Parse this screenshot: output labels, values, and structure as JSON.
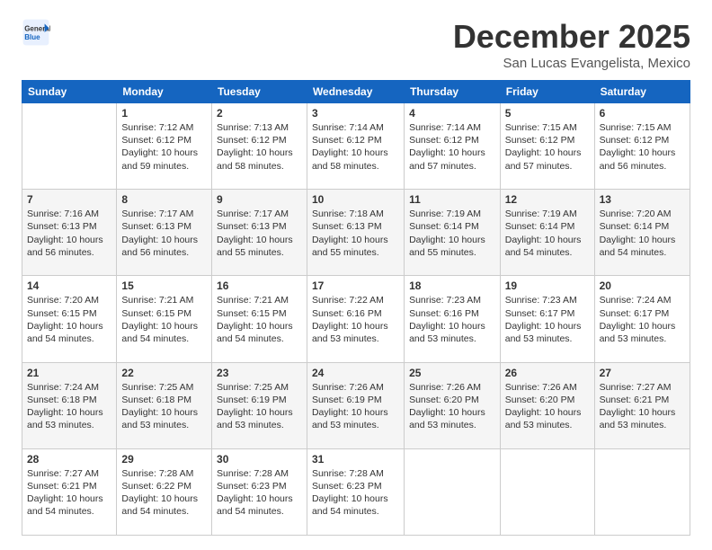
{
  "header": {
    "logo_general": "General",
    "logo_blue": "Blue",
    "month_title": "December 2025",
    "subtitle": "San Lucas Evangelista, Mexico"
  },
  "columns": [
    "Sunday",
    "Monday",
    "Tuesday",
    "Wednesday",
    "Thursday",
    "Friday",
    "Saturday"
  ],
  "weeks": [
    [
      {
        "day": "",
        "info": ""
      },
      {
        "day": "1",
        "info": "Sunrise: 7:12 AM\nSunset: 6:12 PM\nDaylight: 10 hours\nand 59 minutes."
      },
      {
        "day": "2",
        "info": "Sunrise: 7:13 AM\nSunset: 6:12 PM\nDaylight: 10 hours\nand 58 minutes."
      },
      {
        "day": "3",
        "info": "Sunrise: 7:14 AM\nSunset: 6:12 PM\nDaylight: 10 hours\nand 58 minutes."
      },
      {
        "day": "4",
        "info": "Sunrise: 7:14 AM\nSunset: 6:12 PM\nDaylight: 10 hours\nand 57 minutes."
      },
      {
        "day": "5",
        "info": "Sunrise: 7:15 AM\nSunset: 6:12 PM\nDaylight: 10 hours\nand 57 minutes."
      },
      {
        "day": "6",
        "info": "Sunrise: 7:15 AM\nSunset: 6:12 PM\nDaylight: 10 hours\nand 56 minutes."
      }
    ],
    [
      {
        "day": "7",
        "info": "Sunrise: 7:16 AM\nSunset: 6:13 PM\nDaylight: 10 hours\nand 56 minutes."
      },
      {
        "day": "8",
        "info": "Sunrise: 7:17 AM\nSunset: 6:13 PM\nDaylight: 10 hours\nand 56 minutes."
      },
      {
        "day": "9",
        "info": "Sunrise: 7:17 AM\nSunset: 6:13 PM\nDaylight: 10 hours\nand 55 minutes."
      },
      {
        "day": "10",
        "info": "Sunrise: 7:18 AM\nSunset: 6:13 PM\nDaylight: 10 hours\nand 55 minutes."
      },
      {
        "day": "11",
        "info": "Sunrise: 7:19 AM\nSunset: 6:14 PM\nDaylight: 10 hours\nand 55 minutes."
      },
      {
        "day": "12",
        "info": "Sunrise: 7:19 AM\nSunset: 6:14 PM\nDaylight: 10 hours\nand 54 minutes."
      },
      {
        "day": "13",
        "info": "Sunrise: 7:20 AM\nSunset: 6:14 PM\nDaylight: 10 hours\nand 54 minutes."
      }
    ],
    [
      {
        "day": "14",
        "info": "Sunrise: 7:20 AM\nSunset: 6:15 PM\nDaylight: 10 hours\nand 54 minutes."
      },
      {
        "day": "15",
        "info": "Sunrise: 7:21 AM\nSunset: 6:15 PM\nDaylight: 10 hours\nand 54 minutes."
      },
      {
        "day": "16",
        "info": "Sunrise: 7:21 AM\nSunset: 6:15 PM\nDaylight: 10 hours\nand 54 minutes."
      },
      {
        "day": "17",
        "info": "Sunrise: 7:22 AM\nSunset: 6:16 PM\nDaylight: 10 hours\nand 53 minutes."
      },
      {
        "day": "18",
        "info": "Sunrise: 7:23 AM\nSunset: 6:16 PM\nDaylight: 10 hours\nand 53 minutes."
      },
      {
        "day": "19",
        "info": "Sunrise: 7:23 AM\nSunset: 6:17 PM\nDaylight: 10 hours\nand 53 minutes."
      },
      {
        "day": "20",
        "info": "Sunrise: 7:24 AM\nSunset: 6:17 PM\nDaylight: 10 hours\nand 53 minutes."
      }
    ],
    [
      {
        "day": "21",
        "info": "Sunrise: 7:24 AM\nSunset: 6:18 PM\nDaylight: 10 hours\nand 53 minutes."
      },
      {
        "day": "22",
        "info": "Sunrise: 7:25 AM\nSunset: 6:18 PM\nDaylight: 10 hours\nand 53 minutes."
      },
      {
        "day": "23",
        "info": "Sunrise: 7:25 AM\nSunset: 6:19 PM\nDaylight: 10 hours\nand 53 minutes."
      },
      {
        "day": "24",
        "info": "Sunrise: 7:26 AM\nSunset: 6:19 PM\nDaylight: 10 hours\nand 53 minutes."
      },
      {
        "day": "25",
        "info": "Sunrise: 7:26 AM\nSunset: 6:20 PM\nDaylight: 10 hours\nand 53 minutes."
      },
      {
        "day": "26",
        "info": "Sunrise: 7:26 AM\nSunset: 6:20 PM\nDaylight: 10 hours\nand 53 minutes."
      },
      {
        "day": "27",
        "info": "Sunrise: 7:27 AM\nSunset: 6:21 PM\nDaylight: 10 hours\nand 53 minutes."
      }
    ],
    [
      {
        "day": "28",
        "info": "Sunrise: 7:27 AM\nSunset: 6:21 PM\nDaylight: 10 hours\nand 54 minutes."
      },
      {
        "day": "29",
        "info": "Sunrise: 7:28 AM\nSunset: 6:22 PM\nDaylight: 10 hours\nand 54 minutes."
      },
      {
        "day": "30",
        "info": "Sunrise: 7:28 AM\nSunset: 6:23 PM\nDaylight: 10 hours\nand 54 minutes."
      },
      {
        "day": "31",
        "info": "Sunrise: 7:28 AM\nSunset: 6:23 PM\nDaylight: 10 hours\nand 54 minutes."
      },
      {
        "day": "",
        "info": ""
      },
      {
        "day": "",
        "info": ""
      },
      {
        "day": "",
        "info": ""
      }
    ]
  ]
}
